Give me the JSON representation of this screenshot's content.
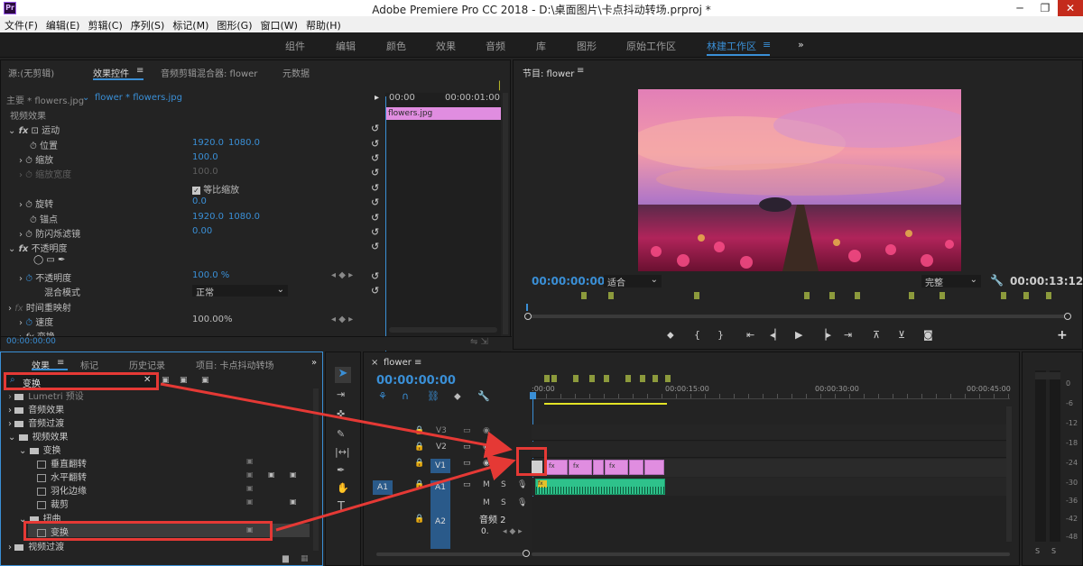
{
  "window": {
    "title": "Adobe Premiere Pro CC 2018 - D:\\桌面图片\\卡点抖动转场.prproj *",
    "app_icon": "Pr"
  },
  "menu": [
    "文件(F)",
    "编辑(E)",
    "剪辑(C)",
    "序列(S)",
    "标记(M)",
    "图形(G)",
    "窗口(W)",
    "帮助(H)"
  ],
  "workspaces": [
    "组件",
    "编辑",
    "颜色",
    "效果",
    "音频",
    "库",
    "图形",
    "原始工作区",
    "林建工作区"
  ],
  "workspace_active": "林建工作区",
  "effect_controls": {
    "tabs": [
      "源:(无剪辑)",
      "效果控件",
      "音频剪辑混合器: flower",
      "元数据"
    ],
    "master": "主要 * flowers.jpg",
    "clip": "flower * flowers.jpg",
    "time_start": "00:00",
    "time_end": "00:00:01:00",
    "clip_label": "flowers.jpg",
    "section": "视频效果",
    "motion": "运动",
    "position": {
      "label": "位置",
      "x": "1920.0",
      "y": "1080.0"
    },
    "scale": {
      "label": "缩放",
      "value": "100.0"
    },
    "scale_width": {
      "label": "缩放宽度",
      "value": "100.0"
    },
    "uniform": "等比缩放",
    "rotation": {
      "label": "旋转",
      "value": "0.0"
    },
    "anchor": {
      "label": "锚点",
      "x": "1920.0",
      "y": "1080.0"
    },
    "antiflicker": {
      "label": "防闪烁滤镜",
      "value": "0.00"
    },
    "opacity_group": "不透明度",
    "opacity": {
      "label": "不透明度",
      "value": "100.0 %"
    },
    "blend": {
      "label": "混合模式",
      "value": "正常"
    },
    "time_remap": "时间重映射",
    "speed": {
      "label": "速度",
      "value": "100.00%"
    },
    "cut_row": "变换",
    "timecode": "00:00:00:00"
  },
  "program": {
    "title": "节目: flower",
    "timecode": "00:00:00:00",
    "fit": "适合",
    "quality": "完整",
    "duration": "00:00:13:12"
  },
  "effects": {
    "tabs": [
      "效果",
      "标记",
      "历史记录",
      "项目: 卡点抖动转场"
    ],
    "search": "变换",
    "items": [
      {
        "label": "Lumetri 预设",
        "level": 0,
        "type": "folder"
      },
      {
        "label": "音频效果",
        "level": 0,
        "type": "folder"
      },
      {
        "label": "音频过渡",
        "level": 0,
        "type": "folder"
      },
      {
        "label": "视频效果",
        "level": 0,
        "type": "folder"
      },
      {
        "label": "变换",
        "level": 1,
        "type": "folder"
      },
      {
        "label": "垂直翻转",
        "level": 2,
        "type": "fx"
      },
      {
        "label": "水平翻转",
        "level": 2,
        "type": "fx"
      },
      {
        "label": "羽化边缘",
        "level": 2,
        "type": "fx"
      },
      {
        "label": "裁剪",
        "level": 2,
        "type": "fx"
      },
      {
        "label": "扭曲",
        "level": 1,
        "type": "folder"
      },
      {
        "label": "变换",
        "level": 2,
        "type": "fx"
      },
      {
        "label": "视频过渡",
        "level": 0,
        "type": "folder"
      }
    ]
  },
  "timeline": {
    "tab": "flower",
    "timecode": "00:00:00:00",
    "ruler": [
      ":00:00",
      "00:00:15:00",
      "00:00:30:00",
      "00:00:45:00"
    ],
    "tracks": [
      "V3",
      "V2",
      "V1",
      "A1",
      "A2"
    ],
    "a2_name": "音频 2",
    "a2_volume": "0.",
    "track_buttons": [
      "M",
      "S"
    ],
    "source_patch_v": "V1",
    "source_patch_a": "A1"
  },
  "meters": [
    "0",
    "-6",
    "-12",
    "-18",
    "-24",
    "-30",
    "-36",
    "-42",
    "-48"
  ],
  "colors": {
    "accent": "#3a8fd6",
    "clip": "#e08de0",
    "audio": "#2ec28b",
    "annotation": "#e53935"
  }
}
